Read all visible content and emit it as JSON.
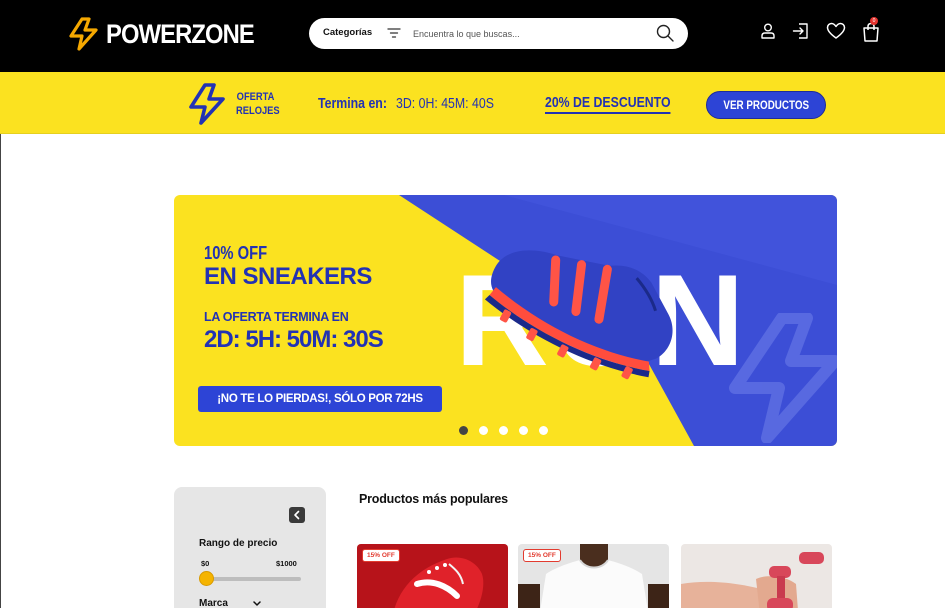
{
  "header": {
    "logo_text": "POWERZONE",
    "categories_label": "Categorías",
    "search_placeholder": "Encuentra lo que buscas...",
    "cart_count": "0"
  },
  "promo_bar": {
    "offer_label_line1": "OFERTA",
    "offer_label_line2": "RELOJES",
    "ends_label": "Termina en:",
    "timer": "3D: 0H: 45M: 40S",
    "discount": "20% DE DESCUENTO",
    "cta": "VER PRODUCTOS"
  },
  "hero": {
    "discount": "10% OFF",
    "title": "EN SNEAKERS",
    "ends_label": "LA OFERTA TERMINA EN",
    "timer": "2D: 5H: 50M: 30S",
    "cta": "¡NO TE LO PIERDAS!, SÓLO POR 72HS",
    "big_word": "RUN",
    "slide_count": 5,
    "active_slide": 1
  },
  "filters": {
    "price_title": "Rango de precio",
    "price_min": "$0",
    "price_max": "$1000",
    "slider_fraction": 0,
    "brand_label": "Marca"
  },
  "products": {
    "section_title": "Productos más populares",
    "items": [
      {
        "badge": "15% OFF",
        "image": "red-sneaker"
      },
      {
        "badge": "15% OFF",
        "image": "white-tshirt"
      },
      {
        "badge": "",
        "image": "red-dumbbell"
      }
    ]
  },
  "colors": {
    "brand_yellow": "#fbe220",
    "brand_blue": "#2d44d6",
    "accent_orange": "#f5a800",
    "badge_red": "#e23b2f"
  },
  "icons": [
    "bolt-icon",
    "filter-icon",
    "search-icon",
    "user-icon",
    "login-icon",
    "heart-icon",
    "cart-icon",
    "chevron-left-icon",
    "chevron-down-icon"
  ]
}
